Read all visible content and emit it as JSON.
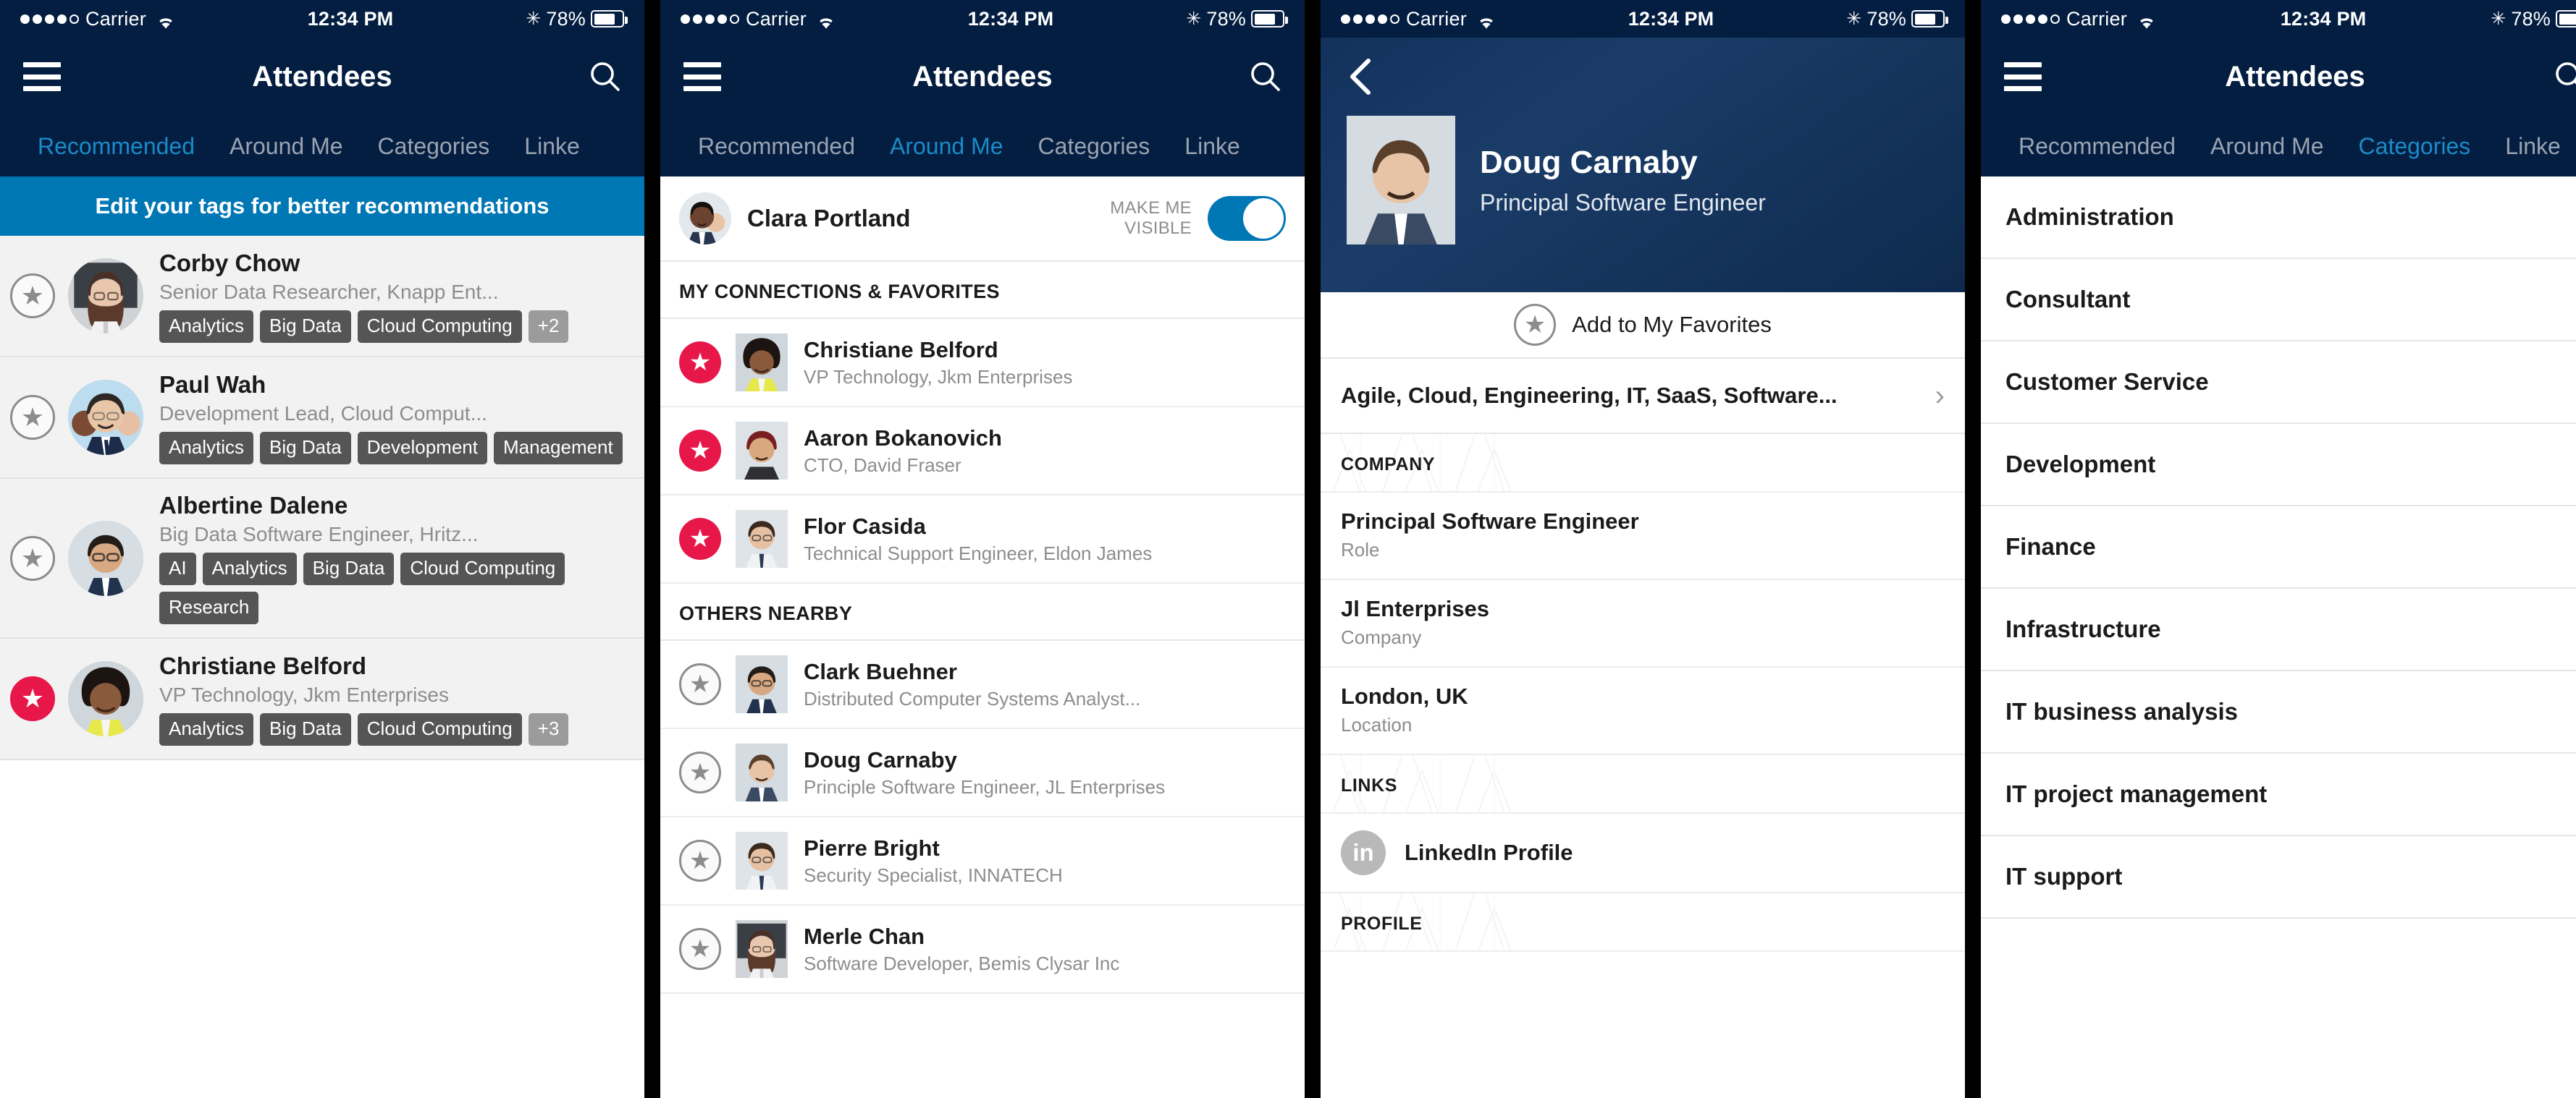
{
  "status_bar": {
    "carrier": "Carrier",
    "time": "12:34 PM",
    "battery": "78%",
    "signal_dots_filled": 4,
    "signal_dots_total": 5,
    "icons": {
      "wifi": "wifi-icon",
      "bluetooth": "bluetooth-icon",
      "battery": "battery-icon"
    }
  },
  "colors": {
    "navy": "#041E42",
    "accent_blue": "#0077B5",
    "active_tab": "#1B8BC8",
    "favorite_red": "#E8174A",
    "tag_gray": "#555555",
    "tag_more_gray": "#9B9B9B"
  },
  "screen1": {
    "title": "Attendees",
    "tabs": [
      {
        "label": "Recommended",
        "active": true
      },
      {
        "label": "Around Me",
        "active": false
      },
      {
        "label": "Categories",
        "active": false
      },
      {
        "label": "Linke",
        "active": false
      }
    ],
    "banner": "Edit your tags for better recommendations",
    "attendees": [
      {
        "name": "Corby Chow",
        "role": "Senior Data Researcher, Knapp Ent...",
        "favorite": false,
        "tags": [
          "Analytics",
          "Big Data",
          "Cloud Computing"
        ],
        "more": "+2"
      },
      {
        "name": "Paul Wah",
        "role": "Development Lead, Cloud Comput...",
        "favorite": false,
        "tags": [
          "Analytics",
          "Big Data",
          "Development",
          "Management"
        ],
        "more": ""
      },
      {
        "name": "Albertine Dalene",
        "role": "Big Data Software Engineer, Hritz...",
        "favorite": false,
        "tags": [
          "AI",
          "Analytics",
          "Big Data",
          "Cloud Computing",
          "Research"
        ],
        "more": ""
      },
      {
        "name": "Christiane Belford",
        "role": "VP Technology, Jkm Enterprises",
        "favorite": true,
        "tags": [
          "Analytics",
          "Big Data",
          "Cloud Computing"
        ],
        "more": "+3"
      }
    ]
  },
  "screen2": {
    "title": "Attendees",
    "tabs": [
      {
        "label": "Recommended",
        "active": false
      },
      {
        "label": "Around Me",
        "active": true
      },
      {
        "label": "Categories",
        "active": false
      },
      {
        "label": "Linke",
        "active": false
      }
    ],
    "me": {
      "name": "Clara Portland",
      "toggle_label_line1": "MAKE ME",
      "toggle_label_line2": "VISIBLE",
      "toggle_on": true
    },
    "section_connections": "MY CONNECTIONS & FAVORITES",
    "connections": [
      {
        "name": "Christiane Belford",
        "role": "VP Technology, Jkm Enterprises",
        "favorite": true
      },
      {
        "name": "Aaron Bokanovich",
        "role": "CTO, David Fraser",
        "favorite": true
      },
      {
        "name": "Flor Casida",
        "role": "Technical Support Engineer, Eldon James",
        "favorite": true
      }
    ],
    "section_nearby": "OTHERS NEARBY",
    "nearby": [
      {
        "name": "Clark Buehner",
        "role": "Distributed Computer Systems Analyst...",
        "favorite": false
      },
      {
        "name": "Doug Carnaby",
        "role": "Principle Software Engineer, JL Enterprises",
        "favorite": false
      },
      {
        "name": "Pierre Bright",
        "role": "Security Specialist, INNATECH",
        "favorite": false
      },
      {
        "name": "Merle Chan",
        "role": "Software Developer, Bemis Clysar Inc",
        "favorite": false
      }
    ]
  },
  "screen3": {
    "back_icon": "back-chevron-icon",
    "person": {
      "name": "Doug Carnaby",
      "title": "Principal Software Engineer"
    },
    "add_favorite": "Add to My Favorites",
    "tags_summary": "Agile, Cloud, Engineering, IT, SaaS, Software...",
    "sections": [
      {
        "header": "COMPANY",
        "rows": [
          {
            "value": "Principal Software Engineer",
            "key": "Role"
          },
          {
            "value": "Jl Enterprises",
            "key": "Company"
          },
          {
            "value": "London, UK",
            "key": "Location"
          }
        ]
      },
      {
        "header": "LINKS",
        "links": [
          {
            "label": "LinkedIn Profile",
            "icon": "linkedin-icon",
            "glyph": "in"
          }
        ]
      },
      {
        "header": "PROFILE",
        "rows": []
      }
    ]
  },
  "screen4": {
    "title": "Attendees",
    "tabs": [
      {
        "label": "Recommended",
        "active": false
      },
      {
        "label": "Around Me",
        "active": false
      },
      {
        "label": "Categories",
        "active": true
      },
      {
        "label": "Linke",
        "active": false
      }
    ],
    "categories": [
      "Administration",
      "Consultant",
      "Customer Service",
      "Development",
      "Finance",
      "Infrastructure",
      "IT business analysis",
      "IT project management",
      "IT support"
    ]
  }
}
